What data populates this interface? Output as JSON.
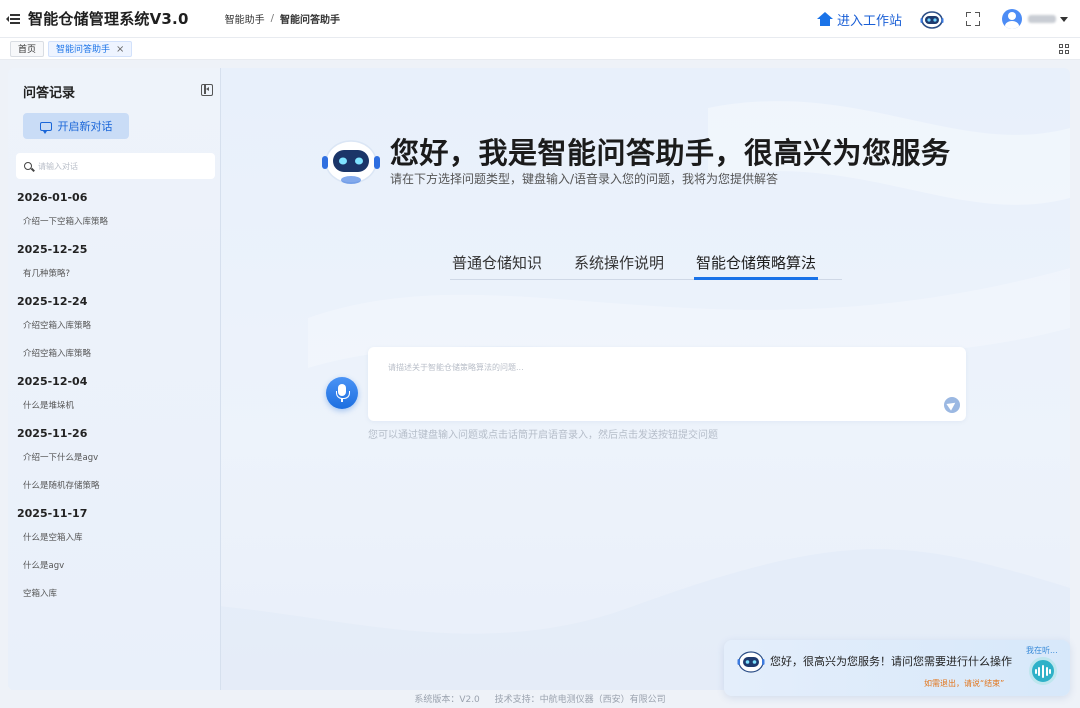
{
  "header": {
    "app_title": "智能仓储管理系统V3.0",
    "breadcrumb": [
      "智能助手",
      "智能问答助手"
    ],
    "workstation_label": "进入工作站"
  },
  "tabs": {
    "items": [
      {
        "label": "首页",
        "active": false
      },
      {
        "label": "智能问答助手",
        "active": true,
        "closable": true
      }
    ],
    "close_glyph": "×"
  },
  "sidebar": {
    "title": "问答记录",
    "new_chat_label": "开启新对话",
    "search_placeholder": "请输入对话",
    "history": [
      {
        "date": "2026-01-06",
        "items": [
          "介绍一下空箱入库策略"
        ]
      },
      {
        "date": "2025-12-25",
        "items": [
          "有几种策略?"
        ]
      },
      {
        "date": "2025-12-24",
        "items": [
          "介绍空箱入库策略",
          "介绍空箱入库策略"
        ]
      },
      {
        "date": "2025-12-04",
        "items": [
          "什么是堆垛机"
        ]
      },
      {
        "date": "2025-11-26",
        "items": [
          "介绍一下什么是agv",
          "什么是随机存储策略"
        ]
      },
      {
        "date": "2025-11-17",
        "items": [
          "什么是空箱入库",
          "什么是agv",
          "空箱入库"
        ]
      }
    ]
  },
  "main": {
    "greeting": "您好，我是智能问答助手，很高兴为您服务",
    "subtitle": "请在下方选择问题类型，键盘输入/语音录入您的问题，我将为您提供解答",
    "question_tabs": [
      {
        "label": "普通仓储知识",
        "active": false
      },
      {
        "label": "系统操作说明",
        "active": false
      },
      {
        "label": "智能仓储策略算法",
        "active": true
      }
    ],
    "input_placeholder": "请描述关于智能仓储策略算法的问题...",
    "hint": "您可以通过键盘输入问题或点击话筒开启语音录入，然后点击发送按钮提交问题"
  },
  "assistant_popup": {
    "message": "您好，很高兴为您服务！请问您需要进行什么操作",
    "status": "我在听...",
    "exit_hint": "如需退出，请说“结束”"
  },
  "footer": {
    "version": "系统版本：V2.0",
    "support": "技术支持：中航电测仪器（西安）有限公司"
  },
  "colors": {
    "accent": "#1a73e8",
    "orange": "#e2761d",
    "teal": "#2fb1c8"
  },
  "icons": [
    "menu-toggle-icon",
    "house-icon",
    "robot-icon",
    "fullscreen-icon",
    "user-avatar-icon",
    "caret-down-icon",
    "grid-icon",
    "collapse-sidebar-icon",
    "chat-icon",
    "search-icon",
    "microphone-icon",
    "send-icon",
    "voice-wave-icon"
  ]
}
